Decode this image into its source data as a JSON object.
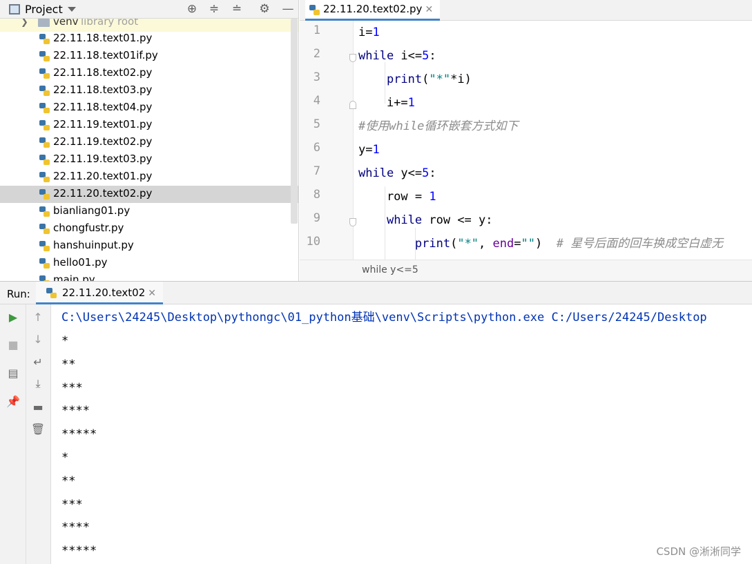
{
  "project_panel": {
    "title": "Project",
    "root": {
      "name": "venv",
      "hint": "library root"
    },
    "files": [
      "22.11.18.text01.py",
      "22.11.18.text01if.py",
      "22.11.18.text02.py",
      "22.11.18.text03.py",
      "22.11.18.text04.py",
      "22.11.19.text01.py",
      "22.11.19.text02.py",
      "22.11.19.text03.py",
      "22.11.20.text01.py",
      "22.11.20.text02.py",
      "bianliang01.py",
      "chongfustr.py",
      "hanshuinput.py",
      "hello01.py",
      "main.py"
    ],
    "selected_index": 9
  },
  "editor": {
    "tab_label": "22.11.20.text02.py",
    "line_numbers": [
      "1",
      "2",
      "3",
      "4",
      "5",
      "6",
      "7",
      "8",
      "9",
      "10"
    ],
    "breadcrumb": "while y<=5",
    "code": [
      [
        {
          "t": "i=",
          "c": ""
        },
        {
          "t": "1",
          "c": "num"
        }
      ],
      [
        {
          "t": "while",
          "c": "kw"
        },
        {
          "t": " i<=",
          "c": ""
        },
        {
          "t": "5",
          "c": "num"
        },
        {
          "t": ":",
          "c": ""
        }
      ],
      [
        {
          "t": "    ",
          "c": ""
        },
        {
          "t": "print",
          "c": "fn"
        },
        {
          "t": "(",
          "c": ""
        },
        {
          "t": "\"*\"",
          "c": "str"
        },
        {
          "t": "*i)",
          "c": ""
        }
      ],
      [
        {
          "t": "    i+=",
          "c": ""
        },
        {
          "t": "1",
          "c": "num"
        }
      ],
      [
        {
          "t": "#使用while循环嵌套方式如下",
          "c": "cmt"
        }
      ],
      [
        {
          "t": "y=",
          "c": ""
        },
        {
          "t": "1",
          "c": "num"
        }
      ],
      [
        {
          "t": "while",
          "c": "kw"
        },
        {
          "t": " y<=",
          "c": ""
        },
        {
          "t": "5",
          "c": "num"
        },
        {
          "t": ":",
          "c": ""
        }
      ],
      [
        {
          "t": "    row = ",
          "c": ""
        },
        {
          "t": "1",
          "c": "num"
        }
      ],
      [
        {
          "t": "    ",
          "c": ""
        },
        {
          "t": "while",
          "c": "kw"
        },
        {
          "t": " row <= y:",
          "c": ""
        }
      ],
      [
        {
          "t": "        ",
          "c": ""
        },
        {
          "t": "print",
          "c": "fn"
        },
        {
          "t": "(",
          "c": ""
        },
        {
          "t": "\"*\"",
          "c": "str"
        },
        {
          "t": ", ",
          "c": ""
        },
        {
          "t": "end",
          "c": "kwarg"
        },
        {
          "t": "=",
          "c": ""
        },
        {
          "t": "\"\"",
          "c": "str"
        },
        {
          "t": ")  ",
          "c": ""
        },
        {
          "t": "# 星号后面的回车换成空白虚无",
          "c": "cmt"
        }
      ]
    ]
  },
  "run_panel": {
    "label": "Run:",
    "tab_label": "22.11.20.text02",
    "command": "C:\\Users\\24245\\Desktop\\pythongc\\01_python基础\\venv\\Scripts\\python.exe C:/Users/24245/Desktop",
    "output_lines": [
      "*",
      "**",
      "***",
      "****",
      "*****",
      "*",
      "**",
      "***",
      "****",
      "*****"
    ]
  },
  "watermark": "CSDN @淅淅同学",
  "colors": {
    "keyword": "#000080",
    "number": "#0000ff",
    "string": "#008080",
    "comment": "#8c8c8c",
    "kwarg": "#660099",
    "command": "#0033b3",
    "accent": "#4083c9",
    "selection": "#d5d5d5"
  }
}
